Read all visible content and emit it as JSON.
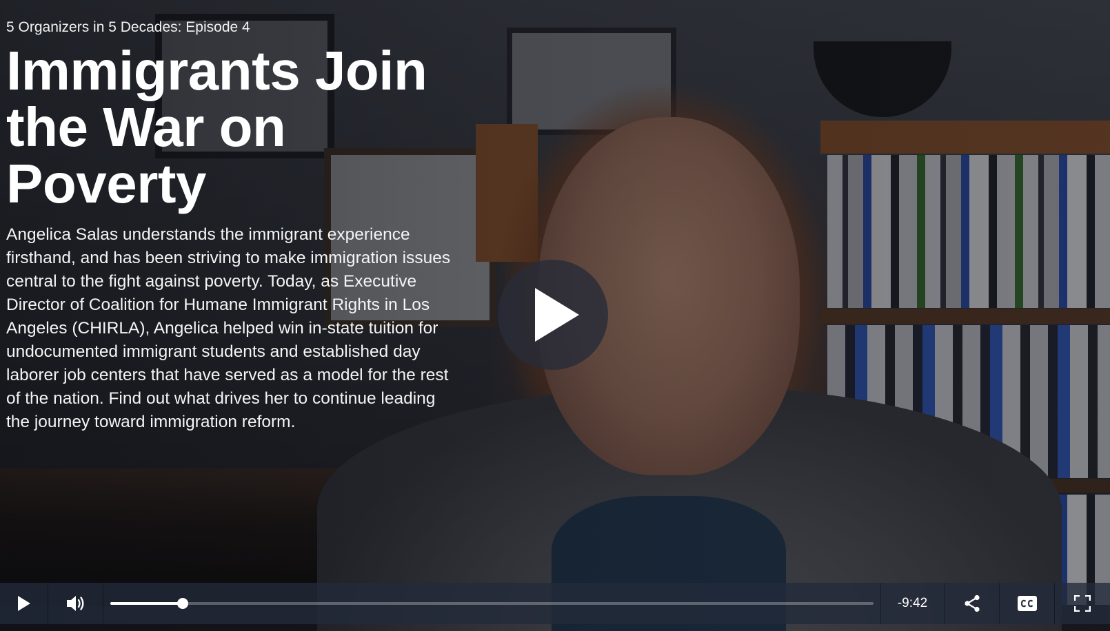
{
  "video": {
    "episode": "5 Organizers in 5 Decades: Episode 4",
    "title": "Immigrants Join the War on Poverty",
    "description": "Angelica Salas understands the immigrant experience firsthand, and has been striving to make immigration issues central to the fight against poverty. Today, as Executive Director of Coalition for Humane Immigrant Rights in Los Angeles (CHIRLA), Angelica helped win in-state tuition for undocumented immigrant students and established day laborer job centers that have served as a model for the rest of the nation. Find out what drives her to continue leading the journey toward immigration reform."
  },
  "controls": {
    "time_remaining": "-9:42",
    "progress_fraction": 0.095,
    "icons": {
      "big_play": "play-icon",
      "play": "play-icon",
      "volume": "volume-icon",
      "share": "share-icon",
      "captions": "cc-icon",
      "fullscreen": "fullscreen-icon"
    }
  }
}
